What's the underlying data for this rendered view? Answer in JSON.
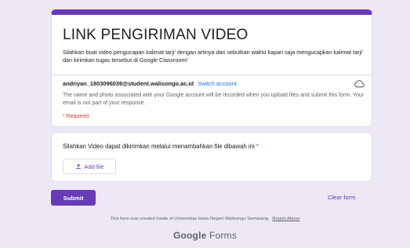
{
  "form": {
    "title": "LINK PENGIRIMAN VIDEO",
    "description": "Silahkan buat video pengucapan kalimat tarji' dengan artinya dan sebutkan waktu kapan saja mengucapkan kalimat tarji' dan kirimkan tugas tersebut di Google Classroom!",
    "account_email": "andriyan_1803096039@student.walisongo.ac.id",
    "switch_account_label": "Switch account",
    "notice": "The name and photo associated with your Google account will be recorded when you upload files and submit this form. Your email is not part of your response.",
    "required_label": "* Required"
  },
  "question": {
    "text": "Silahkan Video dapat dikirimkan melalui menambahkan file dibawah ini",
    "required_mark": "*",
    "add_file_label": "Add file",
    "upload_icon": "upload-icon"
  },
  "actions": {
    "submit_label": "Submit",
    "clear_label": "Clear form"
  },
  "footer": {
    "text": "This form was created inside of Universitas Islam Negeri Walisongo Semarang.",
    "report_abuse_label": "Report Abuse",
    "brand_google": "Google",
    "brand_forms": "Forms"
  },
  "colors": {
    "accent": "#673ab7",
    "background": "#ede7f6",
    "required": "#d93025",
    "link": "#1a73e8"
  }
}
